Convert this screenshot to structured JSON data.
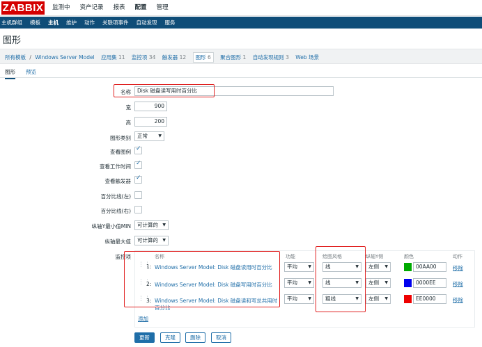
{
  "app": {
    "logo": "ZABBIX"
  },
  "main_menu": [
    {
      "label": "监测中"
    },
    {
      "label": "资产记录"
    },
    {
      "label": "报表"
    },
    {
      "label": "配置",
      "active": true
    },
    {
      "label": "管理"
    }
  ],
  "sub_menu": [
    {
      "label": "主机群组"
    },
    {
      "label": "模板"
    },
    {
      "label": "主机",
      "active": true
    },
    {
      "label": "维护"
    },
    {
      "label": "动作"
    },
    {
      "label": "关联项事件"
    },
    {
      "label": "自动发现"
    },
    {
      "label": "服务"
    }
  ],
  "page_title": "图形",
  "breadcrumb": {
    "all_templates": "所有模板",
    "separator": "/",
    "host": "Windows Server Model",
    "items": [
      {
        "label": "应用集",
        "count": "11"
      },
      {
        "label": "监控项",
        "count": "34"
      },
      {
        "label": "触发器",
        "count": "12"
      },
      {
        "label": "图形",
        "count": "6",
        "selected": true
      },
      {
        "label": "聚合图形",
        "count": "1"
      },
      {
        "label": "自动发现规则",
        "count": "3"
      },
      {
        "label": "Web 场景",
        "count": ""
      }
    ]
  },
  "tabs": {
    "graph": "图形",
    "preview": "预览"
  },
  "form": {
    "name_label": "名称",
    "name_value": "Disk 磁盘读写用时百分比",
    "width_label": "宽",
    "width_value": "900",
    "height_label": "高",
    "height_value": "200",
    "graph_type_label": "图形类别",
    "graph_type_value": "正常",
    "show_legend_label": "查看图例",
    "show_working_time_label": "查看工作时间",
    "show_triggers_label": "查看触发器",
    "percentile_left_label": "百分比线(左)",
    "percentile_right_label": "百分比线(右)",
    "y_min_label": "纵轴Y最小值MIN",
    "y_min_value": "可计算的",
    "y_max_label": "纵轴最大值",
    "y_max_value": "可计算的",
    "items_label": "监控项"
  },
  "items_table": {
    "headers": {
      "name": "名称",
      "function": "功能",
      "draw_style": "绘图风格",
      "y_axis": "纵轴Y侧",
      "color": "颜色",
      "action": "动作"
    },
    "rows": [
      {
        "num": "1:",
        "name": "Windows Server Model: Disk 磁盘读用时百分比",
        "function": "平均",
        "draw_style": "线",
        "y_axis": "左侧",
        "color": "00AA00",
        "color_hex": "#00AA00",
        "action": "移除"
      },
      {
        "num": "2:",
        "name": "Windows Server Model: Disk 磁盘写用时百分比",
        "function": "平均",
        "draw_style": "线",
        "y_axis": "左侧",
        "color": "0000EE",
        "color_hex": "#0000EE",
        "action": "移除"
      },
      {
        "num": "3:",
        "name": "Windows Server Model: Disk 磁盘读和写总共用时百分比",
        "function": "平均",
        "draw_style": "粗线",
        "y_axis": "左侧",
        "color": "EE0000",
        "color_hex": "#EE0000",
        "action": "移除"
      }
    ],
    "add_link": "添加"
  },
  "buttons": {
    "update": "更新",
    "clone": "克隆",
    "delete": "删除",
    "cancel": "取消"
  }
}
